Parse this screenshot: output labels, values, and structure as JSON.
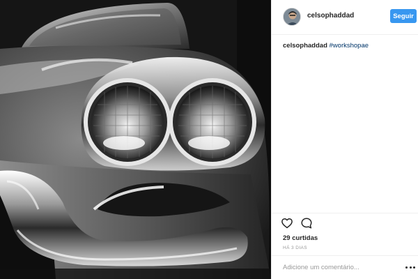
{
  "header": {
    "username": "celsophaddad",
    "follow_label": "Seguir"
  },
  "caption": {
    "username": "celsophaddad",
    "hashtag": "#workshopae"
  },
  "icons": {
    "like": "heart-icon",
    "comment": "speech-bubble-icon",
    "more": "more-dots-icon"
  },
  "stats": {
    "likes": "29 curtidas",
    "time_ago": "HÁ 3 DIAS"
  },
  "comment": {
    "placeholder": "Adicione um comentário..."
  },
  "colors": {
    "accent": "#3897f0",
    "hashtag": "#003569",
    "muted": "#999999"
  }
}
